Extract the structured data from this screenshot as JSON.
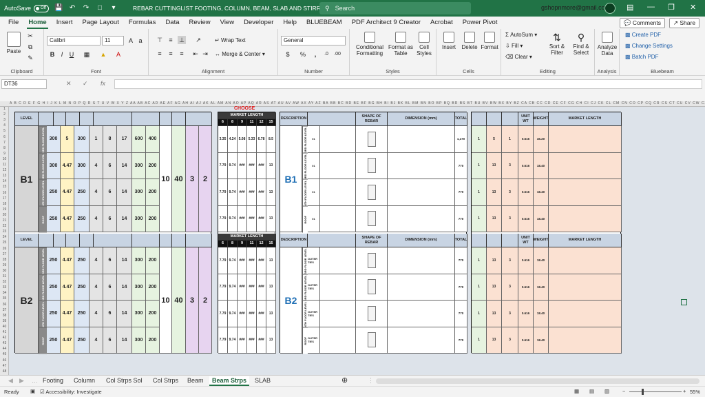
{
  "titlebar": {
    "autosave_label": "AutoSave",
    "autosave_state": "Off",
    "doc_title": "REBAR CUTTINGLIST FOOTING, COLUMN, BEAM, SLAB AND STIRRUPS",
    "search_placeholder": "Search",
    "user_email": "gshopnmore@gmail.com"
  },
  "menu": {
    "items": [
      "File",
      "Home",
      "Insert",
      "Page Layout",
      "Formulas",
      "Data",
      "Review",
      "View",
      "Developer",
      "Help",
      "BLUEBEAM",
      "PDF Architect 9 Creator",
      "Acrobat",
      "Power Pivot"
    ],
    "active": "Home",
    "comments_label": "Comments",
    "share_label": "Share"
  },
  "ribbon": {
    "clipboard": {
      "label": "Clipboard",
      "paste": "Paste"
    },
    "font": {
      "label": "Font",
      "name": "Calibri",
      "size": "11"
    },
    "alignment": {
      "label": "Alignment",
      "wrap": "Wrap Text",
      "merge": "Merge & Center"
    },
    "number": {
      "label": "Number",
      "format": "General"
    },
    "styles": {
      "label": "Styles",
      "cond": "Conditional Formatting",
      "fmt_table": "Format as Table",
      "cell_styles": "Cell Styles"
    },
    "cells": {
      "label": "Cells",
      "insert": "Insert",
      "delete": "Delete",
      "format": "Format"
    },
    "editing": {
      "label": "Editing",
      "autosum": "AutoSum",
      "fill": "Fill",
      "clear": "Clear",
      "sort": "Sort & Filter",
      "find": "Find & Select"
    },
    "analysis": {
      "label": "Analysis",
      "analyze": "Analyze Data"
    },
    "bluebeam": {
      "label": "Bluebeam",
      "create": "Create PDF",
      "change": "Change Settings",
      "batch": "Batch PDF"
    }
  },
  "formula_bar": {
    "name_box": "DT36",
    "fx": "fx",
    "value": ""
  },
  "sheet": {
    "choose_label": "CHOOSE",
    "level_header": "LEVEL",
    "market_length_header": "MARKET LENGTH",
    "ml_sizes": [
      "6",
      "8",
      "9",
      "11",
      "12",
      "15"
    ],
    "description_header": "DESCRIPTION",
    "shape_header": "SHAPE OF REBAR",
    "dimension_header": "DIMENSION (mm)",
    "total_header": "TOTAL",
    "weight_header": "WEIGHT",
    "unit_wt_header": "UNIT WT",
    "levels": [
      {
        "name": "B1",
        "rows": [
          {
            "floor": "3RD FLOOR LEVEL",
            "a": "300",
            "b": "5",
            "c": "300",
            "d": "1",
            "e": "8",
            "f": "17",
            "g": "600",
            "h": "400",
            "ml": "3.35 4.24 5.08 5.33 6.78 8.5",
            "desc": "01",
            "total": "1,170",
            "sets": "1",
            "prod": "5",
            "mkt": "1",
            "unit": "0.616",
            "wt": "45.20"
          },
          {
            "floor": "3RD FLOOR LEVEL",
            "a": "300",
            "b": "4.47",
            "c": "300",
            "d": "4",
            "e": "6",
            "f": "14",
            "g": "300",
            "h": "200",
            "ml": "7.79 9.74 ### ### ### 13",
            "desc": "01",
            "total": "770",
            "sets": "1",
            "prod": "13",
            "mkt": "3",
            "unit": "0.616",
            "wt": "18.40"
          },
          {
            "floor": "4TH FLOOR LEVEL",
            "a": "250",
            "b": "4.47",
            "c": "250",
            "d": "4",
            "e": "6",
            "f": "14",
            "g": "300",
            "h": "200",
            "ml": "7.79 9.74 ### ### ### 13",
            "desc": "01",
            "total": "770",
            "sets": "1",
            "prod": "13",
            "mkt": "3",
            "unit": "0.616",
            "wt": "18.40"
          },
          {
            "floor": "ROOF",
            "a": "250",
            "b": "4.47",
            "c": "250",
            "d": "4",
            "e": "6",
            "f": "14",
            "g": "300",
            "h": "200",
            "ml": "7.79 9.74 ### ### ### 13",
            "desc": "01",
            "total": "770",
            "sets": "1",
            "prod": "13",
            "mkt": "3",
            "unit": "0.616",
            "wt": "18.40"
          }
        ],
        "bar_no": "10",
        "cover": "40",
        "bcA": "3",
        "bcB": "2"
      },
      {
        "name": "B2",
        "rows": [
          {
            "floor": "3RD FLOOR LEVEL",
            "a": "250",
            "b": "4.47",
            "c": "250",
            "d": "4",
            "e": "6",
            "f": "14",
            "g": "300",
            "h": "200",
            "ml": "7.79 9.74 ### ### ### 13",
            "desc": "OUTER TIES",
            "total": "770",
            "sets": "1",
            "prod": "13",
            "mkt": "3",
            "unit": "0.616",
            "wt": "18.40"
          },
          {
            "floor": "3RD FLOOR LEVEL",
            "a": "250",
            "b": "4.47",
            "c": "250",
            "d": "4",
            "e": "6",
            "f": "14",
            "g": "300",
            "h": "200",
            "ml": "7.79 9.74 ### ### ### 13",
            "desc": "OUTER TIES",
            "total": "770",
            "sets": "1",
            "prod": "13",
            "mkt": "3",
            "unit": "0.616",
            "wt": "18.40"
          },
          {
            "floor": "4TH FLOOR LEVEL",
            "a": "250",
            "b": "4.47",
            "c": "250",
            "d": "4",
            "e": "6",
            "f": "14",
            "g": "300",
            "h": "200",
            "ml": "7.79 9.74 ### ### ### 13",
            "desc": "OUTER TIES",
            "total": "770",
            "sets": "1",
            "prod": "13",
            "mkt": "3",
            "unit": "0.616",
            "wt": "18.40"
          },
          {
            "floor": "ROOF",
            "a": "250",
            "b": "4.47",
            "c": "250",
            "d": "4",
            "e": "6",
            "f": "14",
            "g": "300",
            "h": "200",
            "ml": "7.79 9.74 ### ### ### 13",
            "desc": "OUTER TIES",
            "total": "770",
            "sets": "1",
            "prod": "13",
            "mkt": "3",
            "unit": "0.616",
            "wt": "18.40"
          }
        ],
        "bar_no": "10",
        "cover": "40",
        "bcA": "3",
        "bcB": "2"
      }
    ]
  },
  "tabs": {
    "items": [
      "Footing",
      "Column",
      "Col Strps Sol",
      "Col Strps",
      "Beam",
      "Beam Strps",
      "SLAB"
    ],
    "active": "Beam Strps"
  },
  "status": {
    "ready": "Ready",
    "accessibility": "Accessibility: Investigate",
    "zoom": "55%"
  }
}
